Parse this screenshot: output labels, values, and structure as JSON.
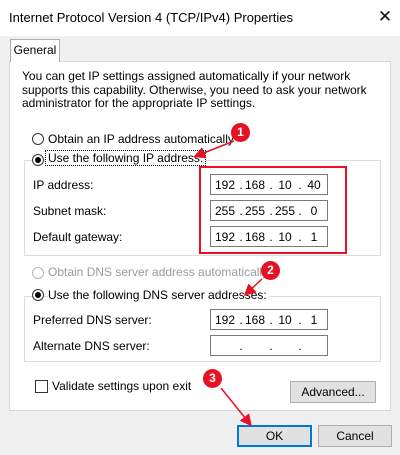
{
  "window": {
    "title": "Internet Protocol Version 4 (TCP/IPv4) Properties",
    "close_glyph": "✕"
  },
  "tabs": [
    {
      "label": "General",
      "selected": true
    }
  ],
  "intro_text": "You can get IP settings assigned automatically if your network supports this capability. Otherwise, you need to ask your network administrator for the appropriate IP settings.",
  "ip_section": {
    "auto_label": "Obtain an IP address automatically",
    "manual_label": "Use the following IP address:",
    "selected": "manual",
    "fields": [
      {
        "label": "IP address:",
        "octets": [
          "192",
          "168",
          "10",
          "40"
        ]
      },
      {
        "label": "Subnet mask:",
        "octets": [
          "255",
          "255",
          "255",
          "0"
        ]
      },
      {
        "label": "Default gateway:",
        "octets": [
          "192",
          "168",
          "10",
          "1"
        ]
      }
    ]
  },
  "dns_section": {
    "auto_label": "Obtain DNS server address automatically",
    "manual_label": "Use the following DNS server addresses:",
    "selected": "manual",
    "fields": [
      {
        "label": "Preferred DNS server:",
        "octets": [
          "192",
          "168",
          "10",
          "1"
        ]
      },
      {
        "label": "Alternate DNS server:",
        "octets": [
          "",
          "",
          "",
          ""
        ]
      }
    ]
  },
  "validate": {
    "label": "Validate settings upon exit",
    "checked": false
  },
  "buttons": {
    "advanced": "Advanced...",
    "ok": "OK",
    "cancel": "Cancel"
  },
  "annotations": {
    "badges": [
      "1",
      "2",
      "3"
    ],
    "color": "#e81123"
  },
  "colors": {
    "focus_border": "#0078d7",
    "dialog_bg": "#f0f0f0"
  }
}
